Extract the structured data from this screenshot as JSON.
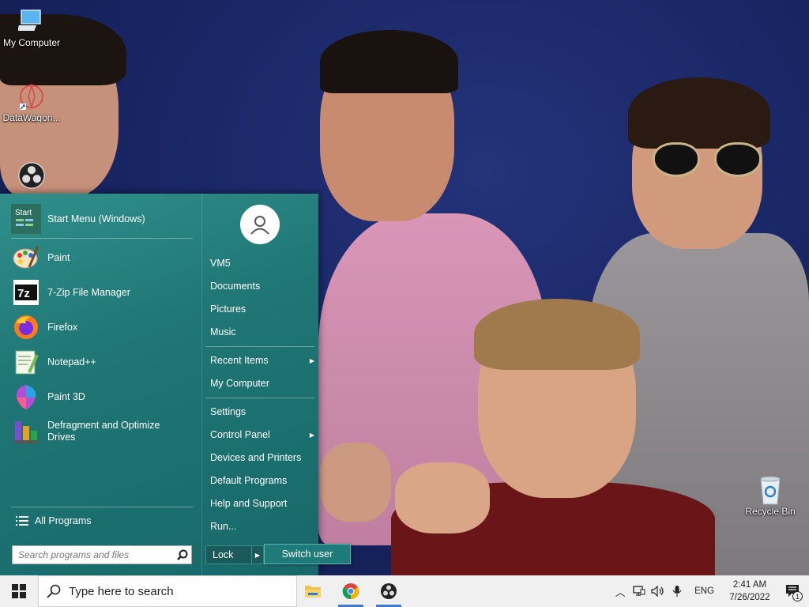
{
  "desktop": {
    "icons": [
      {
        "label": "My Computer",
        "icon": "computer-icon"
      },
      {
        "label": "DataWagon...",
        "icon": "datawagon-shortcut-icon"
      },
      {
        "label": "",
        "icon": "obs-icon"
      },
      {
        "label": "Recycle Bin",
        "icon": "recycle-bin-icon"
      }
    ]
  },
  "start_menu": {
    "pinned_header": "Start Menu (Windows)",
    "programs": [
      {
        "label": "Paint",
        "icon": "paint-icon"
      },
      {
        "label": "7-Zip File Manager",
        "icon": "7zip-icon"
      },
      {
        "label": "Firefox",
        "icon": "firefox-icon"
      },
      {
        "label": "Notepad++",
        "icon": "notepadpp-icon"
      },
      {
        "label": "Paint 3D",
        "icon": "paint3d-icon"
      },
      {
        "label": "Defragment and Optimize Drives",
        "icon": "defrag-icon"
      }
    ],
    "all_programs": "All Programs",
    "search_placeholder": "Search programs and files",
    "right": {
      "user": "VM5",
      "documents": "Documents",
      "pictures": "Pictures",
      "music": "Music",
      "recent_items": "Recent Items",
      "my_computer": "My Computer",
      "settings": "Settings",
      "control_panel": "Control Panel",
      "devices_printers": "Devices and Printers",
      "default_programs": "Default Programs",
      "help_support": "Help and Support",
      "run": "Run..."
    },
    "lock": "Lock",
    "switch_user": "Switch user",
    "start_logo_text": "Start"
  },
  "taskbar": {
    "search_placeholder": "Type here to search",
    "apps": [
      "file-explorer-icon",
      "chrome-icon",
      "obs-icon"
    ],
    "language": "ENG",
    "time": "2:41 AM",
    "date": "7/26/2022",
    "notification_count": "1"
  },
  "colors": {
    "menu_teal": "#1f7674",
    "taskbar": "#f0f0f0",
    "accent": "#3a7bd5"
  }
}
